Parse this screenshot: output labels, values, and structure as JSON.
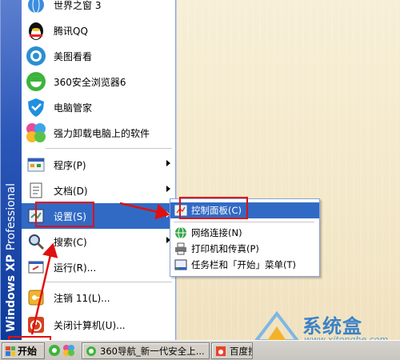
{
  "start_menu": {
    "band_text_bold": "Windows XP",
    "band_text_normal": "Professional",
    "pinned": [
      {
        "label": "世界之窗 3"
      },
      {
        "label": "腾讯QQ"
      },
      {
        "label": "美图看看"
      },
      {
        "label": "360安全浏览器6"
      },
      {
        "label": "电脑管家"
      },
      {
        "label": "强力卸载电脑上的软件"
      }
    ],
    "items": [
      {
        "label": "程序(P)"
      },
      {
        "label": "文档(D)"
      },
      {
        "label": "设置(S)"
      },
      {
        "label": "搜索(C)"
      },
      {
        "label": "运行(R)..."
      },
      {
        "label": "注销 11(L)..."
      },
      {
        "label": "关闭计算机(U)..."
      }
    ]
  },
  "settings_submenu": {
    "items": [
      {
        "label": "控制面板(C)"
      },
      {
        "label": "网络连接(N)"
      },
      {
        "label": "打印机和传真(P)"
      },
      {
        "label": "任务栏和「开始」菜单(T)"
      }
    ]
  },
  "taskbar": {
    "start_label": "开始",
    "tasks": [
      {
        "label": "360导航_新一代安全上..."
      },
      {
        "label": "百度搜"
      }
    ]
  },
  "watermark": {
    "title": "系统盒",
    "url": "www.xitonghe.com"
  },
  "colors": {
    "selection": "#316ac5",
    "annotation_red": "#e01010",
    "xp_band": "#2b57b8"
  }
}
